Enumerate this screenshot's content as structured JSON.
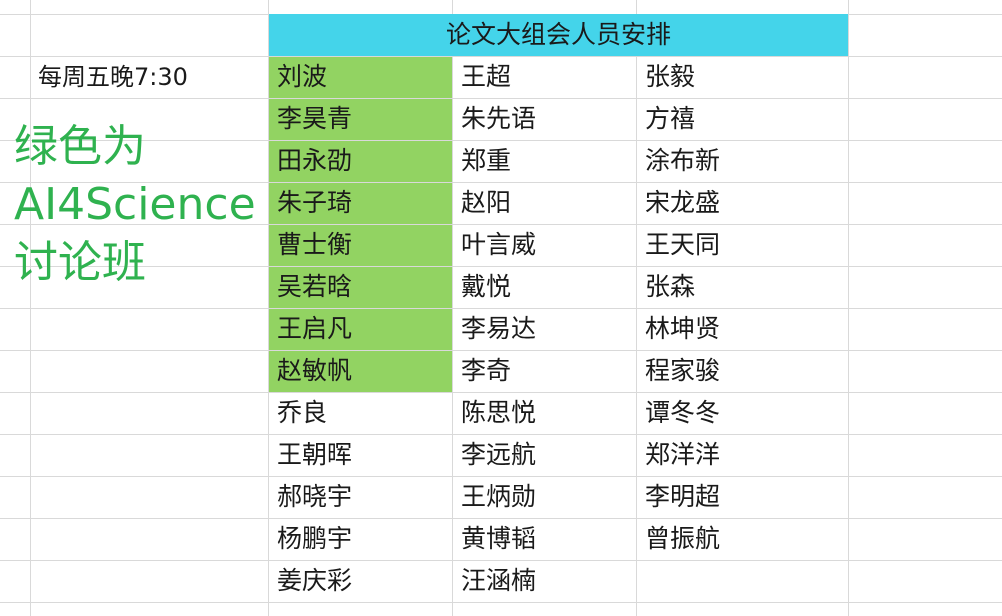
{
  "sheet": {
    "title": "论文大组会人员安排",
    "schedule": "每周五晚7:30",
    "note_lines": [
      "绿色为",
      "AI4Science",
      "讨论班"
    ],
    "columns": [
      [
        "刘波",
        "李昊青",
        "田永劭",
        "朱子琦",
        "曹士衡",
        "吴若晗",
        "王启凡",
        "赵敏帆",
        "乔良",
        "王朝晖",
        "郝晓宇",
        "杨鹏宇",
        "姜庆彩"
      ],
      [
        "王超",
        "朱先语",
        "郑重",
        "赵阳",
        "叶言威",
        "戴悦",
        "李易达",
        "李奇",
        "陈思悦",
        "李远航",
        "王炳勋",
        "黄博韬",
        "汪涵楠"
      ],
      [
        "张毅",
        "方禧",
        "涂布新",
        "宋龙盛",
        "王天同",
        "张森",
        "林坤贤",
        "程家骏",
        "谭冬冬",
        "郑洋洋",
        "李明超",
        "曾振航"
      ]
    ],
    "green_rows_in_first_column": 8,
    "colors": {
      "header_fill": "#44d4ea",
      "highlight_fill": "#92d362",
      "note_text": "#2fb24f",
      "gridline": "#d9d9d9"
    }
  }
}
